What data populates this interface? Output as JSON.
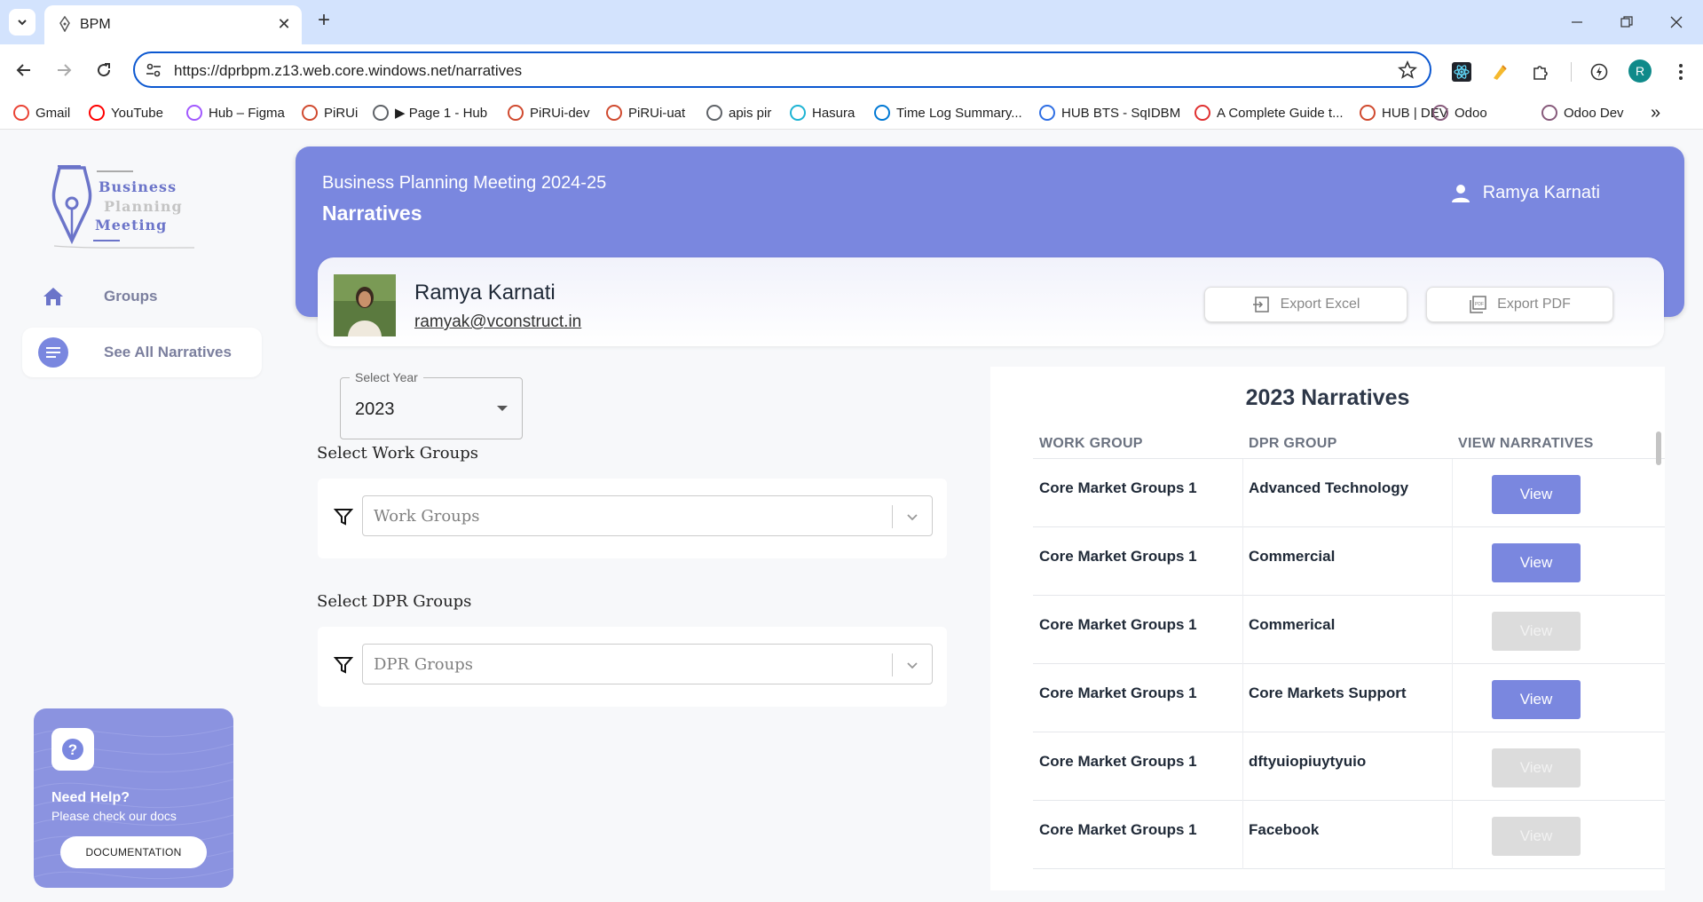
{
  "browser": {
    "tab_title": "BPM",
    "url": "https://dprbpm.z13.web.core.windows.net/narratives",
    "profile_initial": "R",
    "bookmarks": [
      {
        "label": "Gmail",
        "icon": "gmail-icon",
        "color": "#ea4335"
      },
      {
        "label": "YouTube",
        "icon": "youtube-icon",
        "color": "#ff0000"
      },
      {
        "label": "Hub – Figma",
        "icon": "figma-icon",
        "color": "#a259ff"
      },
      {
        "label": "PiRUi",
        "icon": "pirui-icon",
        "color": "#d04a2f"
      },
      {
        "label": "▶ Page 1 - Hub",
        "icon": "video-icon",
        "color": "#5f6368"
      },
      {
        "label": "PiRUi-dev",
        "icon": "pirui-icon",
        "color": "#d04a2f"
      },
      {
        "label": "PiRUi-uat",
        "icon": "pirui-icon",
        "color": "#d04a2f"
      },
      {
        "label": "apis pir",
        "icon": "pen-icon",
        "color": "#5f6368"
      },
      {
        "label": "Hasura",
        "icon": "hasura-icon",
        "color": "#1eb4d4"
      },
      {
        "label": "Time Log Summary...",
        "icon": "azure-icon",
        "color": "#0078d4"
      },
      {
        "label": "HUB BTS - SqIDBM",
        "icon": "db-icon",
        "color": "#2f6fe4"
      },
      {
        "label": "A Complete Guide t...",
        "icon": "asterisk-icon",
        "color": "#e03131"
      },
      {
        "label": "HUB | DEV",
        "icon": "pirui-icon",
        "color": "#d04a2f"
      },
      {
        "label": "Odoo",
        "icon": "odoo-icon",
        "color": "#875a7b"
      },
      {
        "label": "Odoo Dev",
        "icon": "odoo-icon",
        "color": "#875a7b"
      }
    ]
  },
  "logo": {
    "line1": "Business",
    "line2": "Planning",
    "line3": "Meeting"
  },
  "sidebar": {
    "items": [
      {
        "label": "Groups",
        "icon": "home-icon"
      },
      {
        "label": "See All Narratives",
        "icon": "list-icon"
      }
    ]
  },
  "help": {
    "title": "Need Help?",
    "subtitle": "Please check our docs",
    "button": "DOCUMENTATION"
  },
  "header": {
    "subtitle": "Business Planning Meeting 2024-25",
    "title": "Narratives",
    "user": "Ramya Karnati"
  },
  "profile": {
    "name": "Ramya Karnati",
    "email": "ramyak@vconstruct.in",
    "export_excel": "Export Excel",
    "export_pdf": "Export PDF"
  },
  "filters": {
    "year_label": "Select Year",
    "year_value": "2023",
    "work_groups_label": "Select Work Groups",
    "work_groups_placeholder": "Work Groups",
    "dpr_groups_label": "Select DPR Groups",
    "dpr_groups_placeholder": "DPR Groups"
  },
  "table": {
    "title": "2023 Narratives",
    "headers": [
      "WORK GROUP",
      "DPR GROUP",
      "VIEW NARRATIVES"
    ],
    "rows": [
      {
        "work_group": "Core Market Groups 1",
        "dpr_group": "Advanced Technology",
        "view": "View",
        "enabled": true
      },
      {
        "work_group": "Core Market Groups 1",
        "dpr_group": "Commercial",
        "view": "View",
        "enabled": true
      },
      {
        "work_group": "Core Market Groups 1",
        "dpr_group": "Commerical",
        "view": "View",
        "enabled": false
      },
      {
        "work_group": "Core Market Groups 1",
        "dpr_group": "Core Markets Support",
        "view": "View",
        "enabled": true
      },
      {
        "work_group": "Core Market Groups 1",
        "dpr_group": "dftyuiopiuytyuio",
        "view": "View",
        "enabled": false
      },
      {
        "work_group": "Core Market Groups 1",
        "dpr_group": "Facebook",
        "view": "View",
        "enabled": false
      }
    ]
  },
  "colors": {
    "accent": "#7a87df",
    "help_card": "#8b93e0",
    "disabled": "#dcdcdc"
  }
}
